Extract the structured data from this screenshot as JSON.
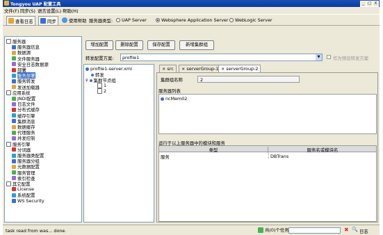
{
  "window": {
    "title": "Tongyou UAP 配置工具",
    "minimize": "_",
    "maximize": "□",
    "close": "X"
  },
  "menu": [
    "文件(F)",
    "同步(S)",
    "语言设置(L)",
    "帮助(H)"
  ],
  "toolbar": {
    "view_log": "查看日志",
    "sync": "同步",
    "use_help": "使用帮助",
    "server_type_label": "服务器类型:",
    "options": [
      "UAP Server",
      "Websphere Application Server",
      "WebLogic Server"
    ],
    "selected_option": "Websphere Application Server"
  },
  "nav": {
    "sections": [
      {
        "label": "服务器",
        "items": [
          "服务器信息",
          "数据源",
          "文件服务器",
          "安全日志数据源",
          "部署",
          "服务部署",
          "服务转发",
          "发送加载器"
        ]
      },
      {
        "label": "应用系统",
        "items": [
          "JNDI配置",
          "日志文件",
          "分布式缓存",
          "缓存引擎",
          "集群消息",
          "数据缓存",
          "代理服务",
          "并发控制"
        ]
      },
      {
        "label": "服务引擎",
        "items": [
          "分词器",
          "服务器类配置",
          "服务器分组",
          "元数据配置",
          "服务管理",
          "索引检查"
        ]
      },
      {
        "label": "其它配置",
        "items": [
          "License",
          "系统配置",
          "WS Security"
        ]
      }
    ],
    "selected_item": "服务部署"
  },
  "actions": {
    "add": "增加配置",
    "delete": "删除配置",
    "save": "保存配置",
    "new_cluster": "新增集群组"
  },
  "scheme": {
    "label": "转发配置方案:",
    "value": "profile1",
    "default_checkbox": "作为预设转发方案"
  },
  "profile_tree": {
    "root": "profile1-server.xml",
    "nodes": [
      "转发",
      "集群节点组"
    ],
    "leaves": [
      "1",
      "2"
    ]
  },
  "tabs": [
    "src",
    "serverGroup-1",
    "serverGroup-2"
  ],
  "active_tab": "serverGroup-2",
  "cluster": {
    "name_label": "集群组名称",
    "name_value": "2",
    "list_label": "服务器列表",
    "servers": [
      "ncMem02"
    ]
  },
  "modules": {
    "label": "运行于以上服务器中的模块和服务",
    "columns": [
      "类型",
      "服务名或模块名"
    ],
    "rows": [
      {
        "type": "服务",
        "name": "DBTrans"
      }
    ]
  },
  "status": {
    "message": "task read from was... done.",
    "tasks_label": "共(0)个任务",
    "log_label": "日志"
  },
  "colors": {
    "titlebar": "#0a3aa0",
    "selection": "#316ac5",
    "chrome": "#ece9d8",
    "table_header": "#dcdcdc"
  }
}
